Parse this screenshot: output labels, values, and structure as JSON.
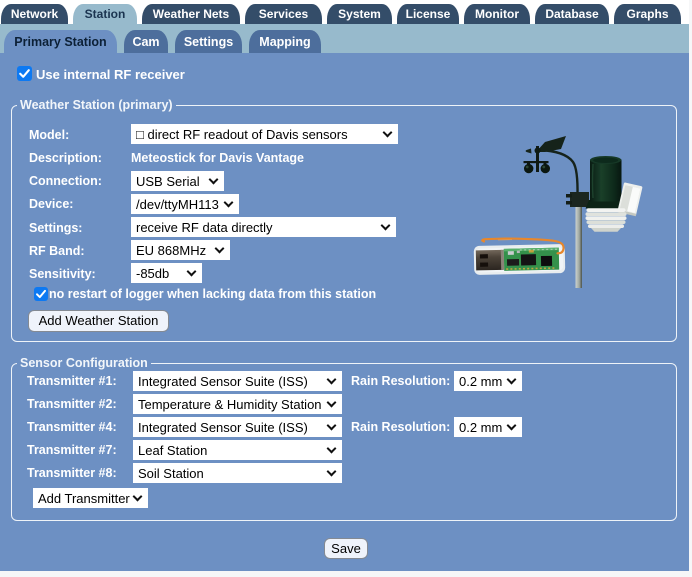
{
  "colors": {
    "content_bg": "#6d90c3",
    "primary_tab_bg": "#344d69",
    "active_pane_bg": "#97bacc",
    "secondary_tab_bg": "#4d6e9c",
    "checkbox_accent": "#0d79f2"
  },
  "tabs_primary": {
    "items": [
      {
        "label": "Network",
        "active": false
      },
      {
        "label": "Station",
        "active": true
      },
      {
        "label": "Weather Nets",
        "active": false
      },
      {
        "label": "Services",
        "active": false
      },
      {
        "label": "System",
        "active": false
      },
      {
        "label": "License",
        "active": false
      },
      {
        "label": "Monitor",
        "active": false
      },
      {
        "label": "Database",
        "active": false
      },
      {
        "label": "Graphs",
        "active": false
      }
    ]
  },
  "tabs_secondary": {
    "items": [
      {
        "label": "Primary Station",
        "active": true
      },
      {
        "label": "Cam",
        "active": false
      },
      {
        "label": "Settings",
        "active": false
      },
      {
        "label": "Mapping",
        "active": false
      }
    ]
  },
  "use_internal_rf": {
    "label": "Use internal RF receiver",
    "checked": true
  },
  "weather_station": {
    "legend": "Weather Station (primary)",
    "model_label": "Model:",
    "model_value": "□ direct RF readout of Davis sensors",
    "description_label": "Description:",
    "description_value": "Meteostick for Davis Vantage",
    "connection_label": "Connection:",
    "connection_value": "USB Serial",
    "device_label": "Device:",
    "device_value": "/dev/ttyMH113",
    "settings_label": "Settings:",
    "settings_value": "receive RF data directly",
    "rf_band_label": "RF Band:",
    "rf_band_value": "EU 868MHz",
    "sensitivity_label": "Sensitivity:",
    "sensitivity_value": "-85db",
    "no_restart": {
      "label": "no restart of logger when lacking data from this station",
      "checked": true
    },
    "add_button": "Add Weather Station",
    "device_image": "davis-vantage-iss-and-meteostick-usb-receiver"
  },
  "sensor_configuration": {
    "legend": "Sensor Configuration",
    "rain_resolution_label": "Rain Resolution:",
    "transmitters": [
      {
        "label": "Transmitter #1:",
        "value": "Integrated Sensor Suite (ISS)",
        "rain_resolution": "0.2 mm"
      },
      {
        "label": "Transmitter #2:",
        "value": "Temperature & Humidity Station",
        "rain_resolution": ""
      },
      {
        "label": "Transmitter #4:",
        "value": "Integrated Sensor Suite (ISS)",
        "rain_resolution": "0.2 mm"
      },
      {
        "label": "Transmitter #7:",
        "value": "Leaf Station",
        "rain_resolution": ""
      },
      {
        "label": "Transmitter #8:",
        "value": "Soil Station",
        "rain_resolution": ""
      }
    ],
    "add_transmitter": "Add Transmitter"
  },
  "save_button": "Save"
}
